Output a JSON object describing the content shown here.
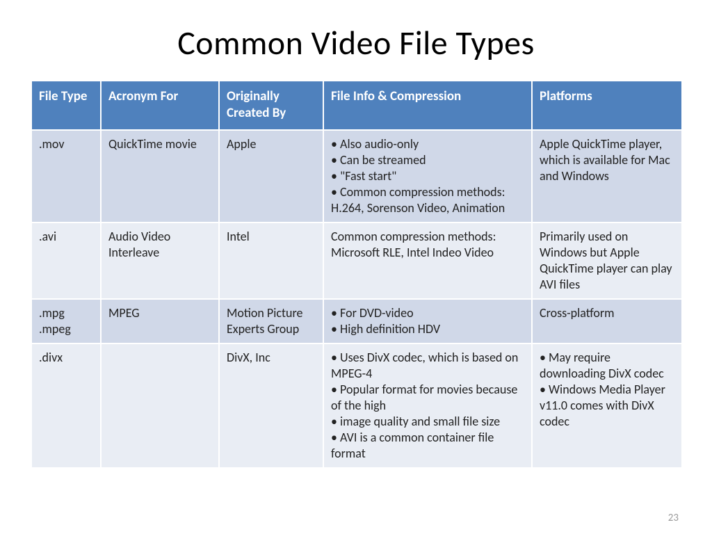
{
  "slide": {
    "title": "Common Video File Types",
    "page_number": "23"
  },
  "table": {
    "headers": {
      "file_type": "File Type",
      "acronym": "Acronym For",
      "originally": "Originally Created By",
      "info": "File Info & Compression",
      "platforms": "Platforms"
    },
    "rows": [
      {
        "file_type_lines": [
          ".mov"
        ],
        "acronym": "QuickTime movie",
        "originally": "Apple",
        "info_bullets": [
          "Also audio-only",
          "Can be streamed",
          "\"Fast start\"",
          "Common compression methods: H.264, Sorenson Video, Animation"
        ],
        "platforms_text": "Apple QuickTime player, which is available for Mac and Windows"
      },
      {
        "file_type_lines": [
          ".avi"
        ],
        "acronym": "Audio Video Interleave",
        "originally": "Intel",
        "info_text": "Common compression methods: Microsoft RLE, Intel Indeo Video",
        "platforms_text": "Primarily used on Windows but Apple QuickTime player can play AVI files"
      },
      {
        "file_type_lines": [
          ".mpg",
          ".mpeg"
        ],
        "acronym": "MPEG",
        "originally": "Motion Picture Experts Group",
        "info_bullets": [
          "For DVD-video",
          "High definition HDV"
        ],
        "platforms_text": "Cross-platform"
      },
      {
        "file_type_lines": [
          ".divx"
        ],
        "acronym": "",
        "originally": "DivX, Inc",
        "info_bullets": [
          "Uses DivX codec, which is based on MPEG-4",
          "Popular format for movies because of the high",
          "image quality and small file size",
          "AVI is a common container file format"
        ],
        "platforms_bullets": [
          "May require downloading DivX codec",
          "Windows Media Player v11.0 comes with DivX codec"
        ]
      }
    ]
  }
}
